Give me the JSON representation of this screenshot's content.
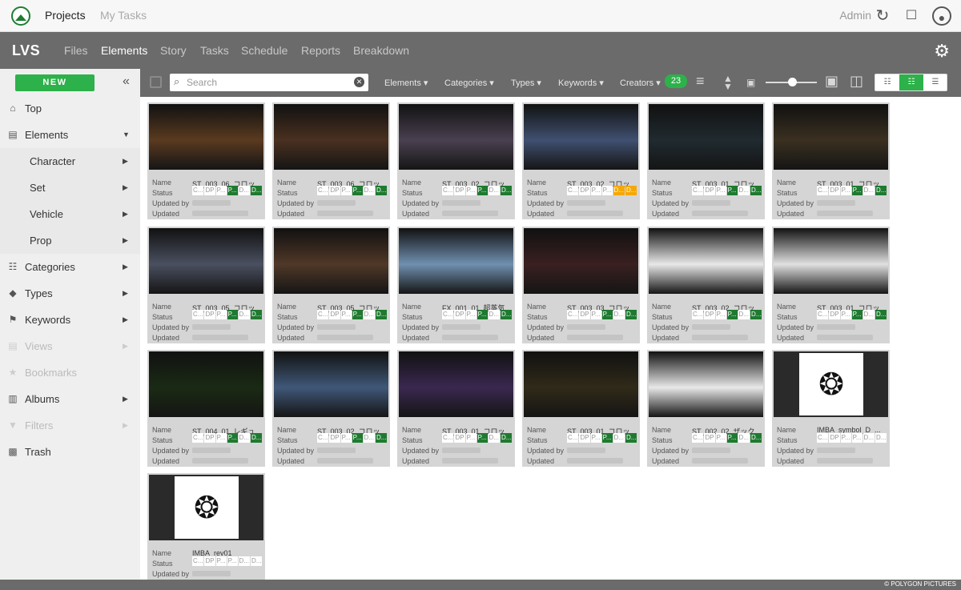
{
  "topbar": {
    "projects": "Projects",
    "my_tasks": "My Tasks",
    "admin": "Admin"
  },
  "nav": {
    "brand": "LVS",
    "links": [
      "Files",
      "Elements",
      "Story",
      "Tasks",
      "Schedule",
      "Reports",
      "Breakdown"
    ],
    "active": "Elements"
  },
  "sidebar": {
    "new_label": "NEW",
    "items": [
      {
        "label": "Top",
        "icon": "home-icon"
      },
      {
        "label": "Elements",
        "icon": "elements-icon"
      },
      {
        "label": "Character",
        "icon": ""
      },
      {
        "label": "Set",
        "icon": ""
      },
      {
        "label": "Vehicle",
        "icon": ""
      },
      {
        "label": "Prop",
        "icon": ""
      },
      {
        "label": "Categories",
        "icon": "categories-icon"
      },
      {
        "label": "Types",
        "icon": "types-icon"
      },
      {
        "label": "Keywords",
        "icon": "keywords-icon"
      },
      {
        "label": "Views",
        "icon": "views-icon"
      },
      {
        "label": "Bookmarks",
        "icon": "star-icon"
      },
      {
        "label": "Albums",
        "icon": "albums-icon"
      },
      {
        "label": "Filters",
        "icon": "filter-icon"
      },
      {
        "label": "Trash",
        "icon": "trash-icon"
      }
    ]
  },
  "toolbar": {
    "search_placeholder": "Search",
    "filters": [
      "Elements",
      "Categories",
      "Types",
      "Keywords",
      "Creators"
    ],
    "count": "23"
  },
  "card_fields": {
    "name": "Name",
    "status": "Status",
    "updated_by": "Updated by",
    "updated": "Updated"
  },
  "status_chips": [
    "C...",
    "DP",
    "P...",
    "P...",
    "D...",
    "D..."
  ],
  "cards": [
    {
      "name": "ST_003_06_コロッ...",
      "green": [
        3,
        5
      ],
      "yellow": [],
      "thumb": "#5a3a20"
    },
    {
      "name": "ST_003_06_コロッ...",
      "green": [
        3,
        5
      ],
      "yellow": [],
      "thumb": "#4a3020"
    },
    {
      "name": "ST_003_02_コロッ...",
      "green": [
        3,
        5
      ],
      "yellow": [],
      "thumb": "#4a4050"
    },
    {
      "name": "ST_003_02_コロッ...",
      "green": [],
      "yellow": [
        4,
        5
      ],
      "thumb": "#405070"
    },
    {
      "name": "ST_003_01_コロッ...",
      "green": [
        3,
        5
      ],
      "yellow": [],
      "thumb": "#202a30"
    },
    {
      "name": "ST_003_01_コロッ...",
      "green": [
        3,
        5
      ],
      "yellow": [],
      "thumb": "#3a3020"
    },
    {
      "name": "ST_003_05_コロッ...",
      "green": [
        3,
        5
      ],
      "yellow": [],
      "thumb": "#4a5060"
    },
    {
      "name": "ST_003_05_コロッ...",
      "green": [
        3,
        5
      ],
      "yellow": [],
      "thumb": "#503828"
    },
    {
      "name": "FX_001_01_超蒸気...",
      "green": [
        3,
        5
      ],
      "yellow": [],
      "thumb": "#7090b0"
    },
    {
      "name": "ST_003_03_コロッ...",
      "green": [
        3,
        5
      ],
      "yellow": [],
      "thumb": "#3a2020"
    },
    {
      "name": "ST_003_02_コロッ...",
      "green": [
        3,
        5
      ],
      "yellow": [],
      "thumb": "#e8e8e8"
    },
    {
      "name": "ST_003_01_コロッ...",
      "green": [
        3,
        5
      ],
      "yellow": [],
      "thumb": "#e0e0e0"
    },
    {
      "name": "ST_004_01_レギュ...",
      "green": [
        3,
        5
      ],
      "yellow": [],
      "thumb": "#1a2a14"
    },
    {
      "name": "ST_003_02_コロッ...",
      "green": [
        3,
        5
      ],
      "yellow": [],
      "thumb": "#405878"
    },
    {
      "name": "ST_003_01_コロッ...",
      "green": [
        3,
        5
      ],
      "yellow": [],
      "thumb": "#3a2850"
    },
    {
      "name": "ST_003_01_コロッ...",
      "green": [
        3,
        5
      ],
      "yellow": [],
      "thumb": "#302a18"
    },
    {
      "name": "ST_002_02_ザック...",
      "green": [
        3,
        5
      ],
      "yellow": [],
      "thumb": "#e8e8e8"
    },
    {
      "name": "IMBA_symbol_D_...",
      "green": [],
      "yellow": [],
      "thumb": "#ffffff"
    },
    {
      "name": "IMBA_rev01",
      "green": [],
      "yellow": [],
      "thumb": "#ffffff"
    }
  ],
  "footer": "© POLYGON PICTURES"
}
